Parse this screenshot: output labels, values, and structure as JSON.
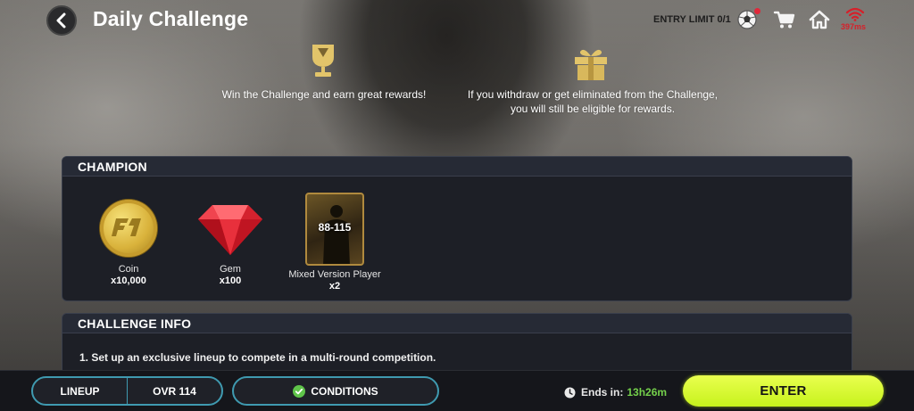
{
  "header": {
    "title": "Daily Challenge",
    "entry_limit": "ENTRY LIMIT 0/1",
    "ping": "397ms"
  },
  "blurbs": [
    {
      "icon": "trophy-icon",
      "text": "Win the Challenge and earn great rewards!"
    },
    {
      "icon": "gift-icon",
      "text": "If you withdraw or get eliminated from the Challenge, you will still be eligible for rewards."
    }
  ],
  "champion": {
    "heading": "CHAMPION",
    "rewards": [
      {
        "name": "Coin",
        "qty": "x10,000"
      },
      {
        "name": "Gem",
        "qty": "x100"
      },
      {
        "name": "Mixed Version Player",
        "qty": "x2",
        "rating": "88-115"
      }
    ]
  },
  "challenge_info": {
    "heading": "CHALLENGE INFO",
    "lines": [
      "1.  Set up an exclusive lineup to compete in a multi-round competition."
    ]
  },
  "bottom": {
    "lineup_label": "LINEUP",
    "ovr": "OVR 114",
    "conditions_label": "CONDITIONS",
    "ends_label": "Ends in:",
    "ends_time": "13h26m",
    "enter_label": "ENTER"
  },
  "colors": {
    "accent_green": "#c7f21c",
    "timer_green": "#74d04b",
    "pill_border": "#3f9ab0",
    "ping_red": "#d6202a",
    "gold": "#d9b23b"
  }
}
